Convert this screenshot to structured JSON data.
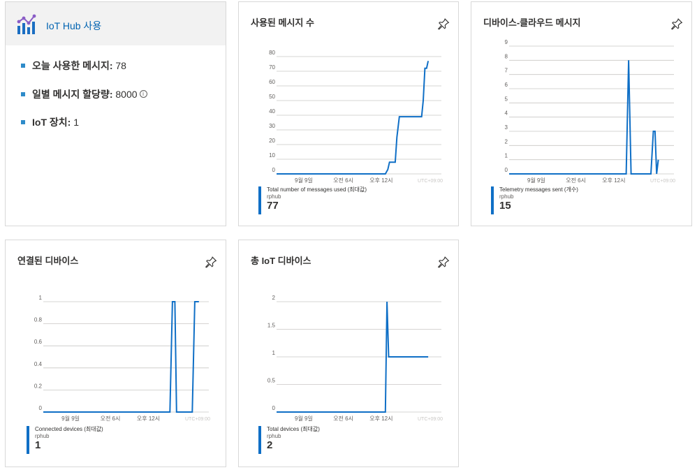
{
  "usage": {
    "title": "IoT Hub 사용",
    "items": [
      {
        "label": "오늘 사용한 메시지:",
        "value": " 78"
      },
      {
        "label": "일별 메시지 할당량:",
        "value": " 8000"
      },
      {
        "label": "IoT 장치:",
        "value": " 1"
      }
    ],
    "info_icon": "info-icon"
  },
  "colors": {
    "series": "#0f6fc6",
    "grid": "#c8c6c4",
    "axis_text": "#605e5c",
    "accent": "#0063b1"
  },
  "timezone": "UTC+09:00",
  "charts": [
    {
      "id": "messages-used",
      "title": "사용된 메시지 수",
      "legend_name": "Total number of messages used (최대값)",
      "resource": "rphub",
      "value": "77",
      "chart_data": {
        "type": "line",
        "x_ticks": [
          "9월 9일",
          "오전 6시",
          "오후 12시"
        ],
        "y_ticks": [
          "80",
          "70",
          "60",
          "50",
          "40",
          "30",
          "20",
          "10",
          "0"
        ],
        "ylim": [
          0,
          80
        ],
        "points": [
          [
            0,
            0
          ],
          [
            0.66,
            0
          ],
          [
            0.675,
            3
          ],
          [
            0.685,
            8
          ],
          [
            0.72,
            8
          ],
          [
            0.73,
            25
          ],
          [
            0.745,
            39
          ],
          [
            0.88,
            39
          ],
          [
            0.89,
            50
          ],
          [
            0.9,
            72
          ],
          [
            0.91,
            72
          ],
          [
            0.92,
            77
          ]
        ]
      }
    },
    {
      "id": "d2c-messages",
      "title": "디바이스-클라우드 메시지",
      "legend_name": "Telemetry messages sent (개수)",
      "resource": "rphub",
      "value": "15",
      "chart_data": {
        "type": "line",
        "x_ticks": [
          "9월 9일",
          "오전 6시",
          "오후 12시"
        ],
        "y_ticks": [
          "9",
          "8",
          "7",
          "6",
          "5",
          "4",
          "3",
          "2",
          "1",
          "0"
        ],
        "ylim": [
          0,
          9
        ],
        "points": [
          [
            0,
            0
          ],
          [
            0.71,
            0
          ],
          [
            0.725,
            8
          ],
          [
            0.74,
            0
          ],
          [
            0.86,
            0
          ],
          [
            0.875,
            3
          ],
          [
            0.885,
            3
          ],
          [
            0.895,
            0
          ],
          [
            0.905,
            1
          ]
        ]
      }
    },
    {
      "id": "connected-devices",
      "title": "연결된 디바이스",
      "legend_name": "Connected devices (최대값)",
      "resource": "rphub",
      "value": "1",
      "chart_data": {
        "type": "line",
        "x_ticks": [
          "9월 9일",
          "오전 6시",
          "오후 12시"
        ],
        "y_ticks": [
          "1",
          "0.8",
          "0.6",
          "0.4",
          "0.2",
          "0"
        ],
        "ylim": [
          0,
          1
        ],
        "points": [
          [
            0,
            0
          ],
          [
            0.765,
            0
          ],
          [
            0.78,
            1
          ],
          [
            0.795,
            1
          ],
          [
            0.805,
            0
          ],
          [
            0.9,
            0
          ],
          [
            0.915,
            1
          ],
          [
            0.94,
            1
          ]
        ]
      }
    },
    {
      "id": "total-devices",
      "title": "총 IoT 디바이스",
      "legend_name": "Total devices (최대값)",
      "resource": "rphub",
      "value": "2",
      "chart_data": {
        "type": "line",
        "x_ticks": [
          "9월 9일",
          "오전 6시",
          "오후 12시"
        ],
        "y_ticks": [
          "2",
          "1.5",
          "1",
          "0.5",
          "0"
        ],
        "ylim": [
          0,
          2
        ],
        "points": [
          [
            0,
            0
          ],
          [
            0.66,
            0
          ],
          [
            0.67,
            2
          ],
          [
            0.68,
            1
          ],
          [
            0.92,
            1
          ]
        ]
      }
    }
  ]
}
